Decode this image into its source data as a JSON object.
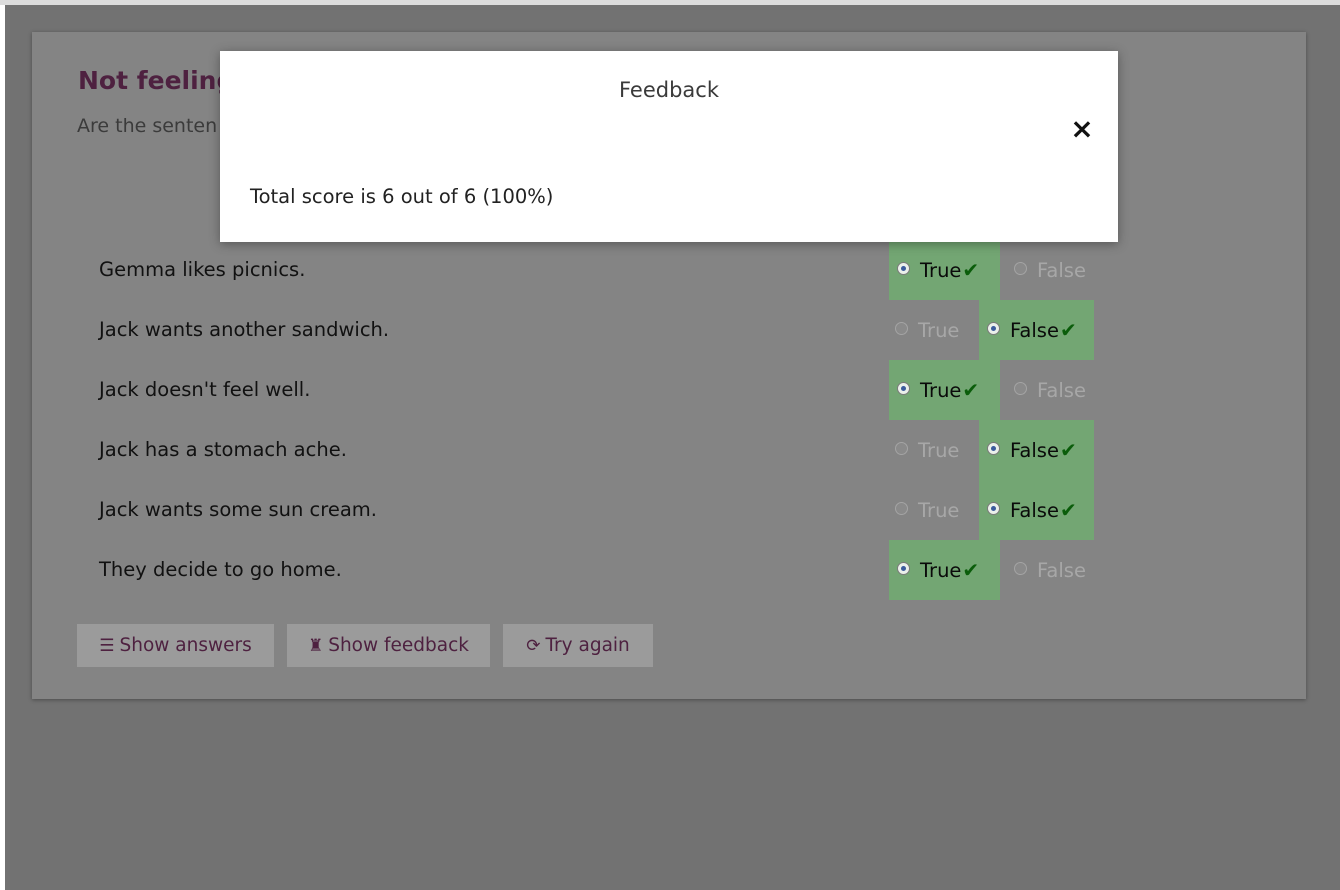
{
  "activity": {
    "title": "Not feeling",
    "subtitle": "Are the senten"
  },
  "statements": [
    {
      "text": "Gemma likes picnics.",
      "selected": "True"
    },
    {
      "text": "Jack wants another sandwich.",
      "selected": "False"
    },
    {
      "text": "Jack doesn't feel well.",
      "selected": "True"
    },
    {
      "text": "Jack has a stomach ache.",
      "selected": "False"
    },
    {
      "text": "Jack wants some sun cream.",
      "selected": "False"
    },
    {
      "text": "They decide to go home.",
      "selected": "True"
    }
  ],
  "options": {
    "true_label": "True",
    "false_label": "False",
    "correct_mark": "✔"
  },
  "buttons": {
    "show_answers": "Show answers",
    "show_feedback": "Show feedback",
    "try_again": "Try again"
  },
  "icons": {
    "show_answers": "list-icon",
    "show_feedback": "rook-icon",
    "try_again": "refresh-icon",
    "close": "close-icon"
  },
  "modal": {
    "title": "Feedback",
    "close_glyph": "×",
    "score_text": "Total score is 6 out of 6 (100%)"
  },
  "colors": {
    "accent": "#4e2140",
    "correct_bg": "#73a673",
    "check": "#0b5d0b",
    "overlay": "#727272"
  }
}
